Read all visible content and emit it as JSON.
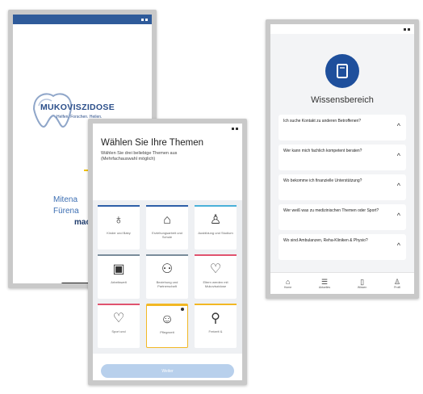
{
  "phone1": {
    "logo": {
      "name": "MUKOVISZIDOSE",
      "suffix": "e.V.",
      "tagline": "Helfen. Forschen. Heilen."
    },
    "text_lines": [
      "Mitena",
      "Fürena",
      "mach"
    ]
  },
  "phone2": {
    "title": "Wählen Sie Ihre Themen",
    "subtitle": "Wählen Sie drei beliebige Themen aus (Mehrfachauswahl möglich)",
    "tiles": [
      {
        "label": "Kinder und Baby",
        "icon": "baby-bottle-icon",
        "accent": "#2e5fa8"
      },
      {
        "label": "Erziehungsarbeit und Schule",
        "icon": "school-icon",
        "accent": "#2e5fa8"
      },
      {
        "label": "Ausbildung und Studium",
        "icon": "graduation-icon",
        "accent": "#4ab0d9"
      },
      {
        "label": "Arbeitswelt",
        "icon": "briefcase-icon",
        "accent": "#7a8c9b"
      },
      {
        "label": "Beziehung und Partnerschaft",
        "icon": "people-icon",
        "accent": "#7a8c9b"
      },
      {
        "label": "Eltern werden mit Mukoviszidose",
        "icon": "heart-hands-icon",
        "accent": "#e0536f"
      },
      {
        "label": "Sport und",
        "icon": "heart-monitor-icon",
        "accent": "#e0536f"
      },
      {
        "label": "Pflegezeit",
        "icon": "person-icon",
        "accent": "#f2b824"
      },
      {
        "label": "Freizeit &",
        "icon": "walking-icon",
        "accent": "#f2b824"
      }
    ],
    "button_label": "Weiter"
  },
  "phone3": {
    "title": "Wissensbereich",
    "faq": [
      "Ich suche Kontakt zu anderen Betroffenen?",
      "Wer kann mich fachlich kompetent beraten?",
      "Wo bekomme ich finanzielle Unterstützung?",
      "Wer weiß was zu medizinischen Themen oder Sport?",
      "Wo sind Ambulanzen, Reha-Kliniken & Physio?"
    ],
    "tabs": [
      "Home",
      "Aktuelles",
      "Wissen",
      "Profil"
    ]
  }
}
